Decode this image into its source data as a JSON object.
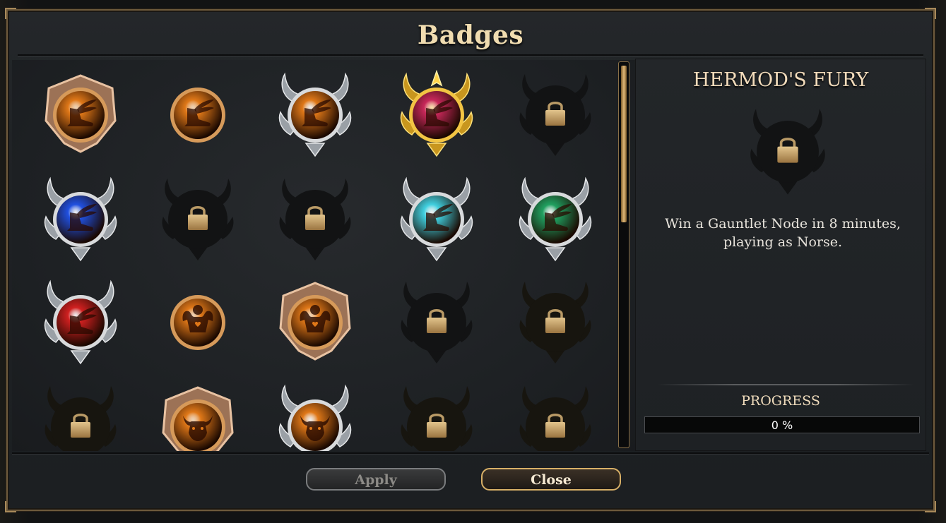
{
  "window": {
    "title": "Badges"
  },
  "colors": {
    "accent": "#d8b067",
    "title_text": "#f0dcb0",
    "locked": "#141516"
  },
  "badges": [
    {
      "state": "unlocked",
      "frame": "bronze",
      "orb": "#e07818",
      "emblem": "winged-boot"
    },
    {
      "state": "unlocked",
      "frame": "ring",
      "orb": "#e07818",
      "emblem": "winged-boot"
    },
    {
      "state": "unlocked",
      "frame": "silver",
      "orb": "#e07818",
      "emblem": "winged-boot"
    },
    {
      "state": "unlocked",
      "frame": "gold",
      "orb": "#c8285a",
      "emblem": "winged-boot"
    },
    {
      "state": "locked",
      "frame": "silver"
    },
    {
      "state": "unlocked",
      "frame": "silver",
      "orb": "#2050e0",
      "emblem": "winged-boot"
    },
    {
      "state": "locked",
      "frame": "silver"
    },
    {
      "state": "locked",
      "frame": "silver"
    },
    {
      "state": "unlocked",
      "frame": "silver",
      "orb": "#40d0e0",
      "emblem": "winged-boot"
    },
    {
      "state": "unlocked",
      "frame": "silver",
      "orb": "#20a060",
      "emblem": "winged-boot"
    },
    {
      "state": "unlocked",
      "frame": "silver",
      "orb": "#d02020",
      "emblem": "winged-boot"
    },
    {
      "state": "unlocked",
      "frame": "ring",
      "orb": "#e07818",
      "emblem": "strongman"
    },
    {
      "state": "unlocked",
      "frame": "bronze",
      "orb": "#e07818",
      "emblem": "strongman"
    },
    {
      "state": "locked",
      "frame": "silver"
    },
    {
      "state": "locked",
      "frame": "gold"
    },
    {
      "state": "locked",
      "frame": "gold"
    },
    {
      "state": "unlocked",
      "frame": "bronze",
      "orb": "#e07818",
      "emblem": "bull"
    },
    {
      "state": "unlocked",
      "frame": "silver",
      "orb": "#e07818",
      "emblem": "bull"
    },
    {
      "state": "locked",
      "frame": "gold"
    },
    {
      "state": "locked",
      "frame": "gold"
    }
  ],
  "detail": {
    "title": "HERMOD'S FURY",
    "icon": "lock-icon",
    "description": "Win a Gauntlet Node in 8 minutes, playing as Norse.",
    "progress_label": "PROGRESS",
    "progress_value": 0,
    "progress_text": "0 %"
  },
  "buttons": {
    "apply": "Apply",
    "close": "Close"
  }
}
